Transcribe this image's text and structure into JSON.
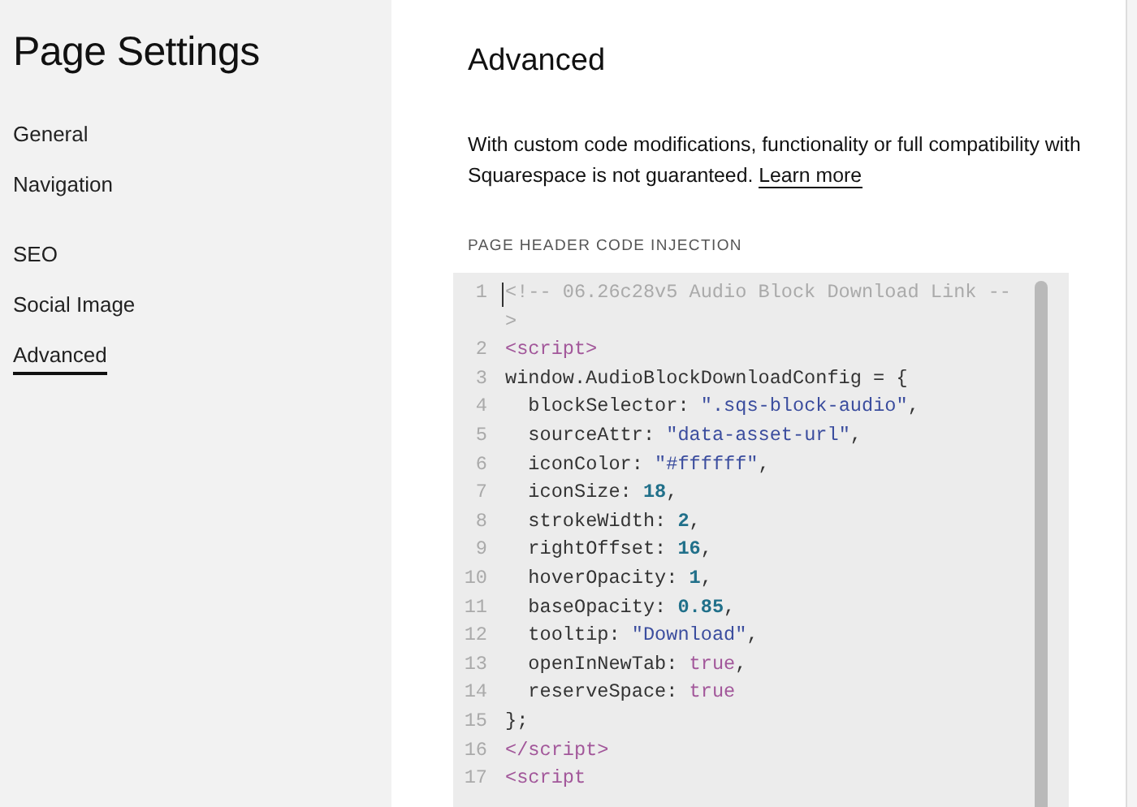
{
  "sidebar": {
    "title": "Page Settings",
    "sections": [
      {
        "items": [
          {
            "label": "General",
            "selected": false
          },
          {
            "label": "Navigation",
            "selected": false
          }
        ]
      },
      {
        "items": [
          {
            "label": "SEO",
            "selected": false
          },
          {
            "label": "Social Image",
            "selected": false
          },
          {
            "label": "Advanced",
            "selected": true
          }
        ]
      }
    ]
  },
  "main": {
    "title": "Advanced",
    "notice": {
      "text": "With custom code modifications, functionality or full compatibility with Squarespace is not guaranteed.",
      "link": "Learn more"
    },
    "code_injection": {
      "label": "PAGE HEADER CODE INJECTION",
      "lines": [
        {
          "number": "1",
          "tokens": [
            {
              "kind": "comment",
              "text": "<!-- 06.26c28v5 Audio Block Download Link -->"
            }
          ]
        },
        {
          "number": "2",
          "tokens": [
            {
              "kind": "tag",
              "text": "<script>"
            }
          ]
        },
        {
          "number": "3",
          "tokens": [
            {
              "kind": "plain",
              "text": "window.AudioBlockDownloadConfig = {"
            }
          ]
        },
        {
          "number": "4",
          "tokens": [
            {
              "kind": "plain",
              "text": "  blockSelector: "
            },
            {
              "kind": "string",
              "text": "\".sqs-block-audio\""
            },
            {
              "kind": "plain",
              "text": ","
            }
          ]
        },
        {
          "number": "5",
          "tokens": [
            {
              "kind": "plain",
              "text": "  sourceAttr: "
            },
            {
              "kind": "string",
              "text": "\"data-asset-url\""
            },
            {
              "kind": "plain",
              "text": ","
            }
          ]
        },
        {
          "number": "6",
          "tokens": [
            {
              "kind": "plain",
              "text": "  iconColor: "
            },
            {
              "kind": "string",
              "text": "\"#ffffff\""
            },
            {
              "kind": "plain",
              "text": ","
            }
          ]
        },
        {
          "number": "7",
          "tokens": [
            {
              "kind": "plain",
              "text": "  iconSize: "
            },
            {
              "kind": "number",
              "text": "18"
            },
            {
              "kind": "plain",
              "text": ","
            }
          ]
        },
        {
          "number": "8",
          "tokens": [
            {
              "kind": "plain",
              "text": "  strokeWidth: "
            },
            {
              "kind": "number",
              "text": "2"
            },
            {
              "kind": "plain",
              "text": ","
            }
          ]
        },
        {
          "number": "9",
          "tokens": [
            {
              "kind": "plain",
              "text": "  rightOffset: "
            },
            {
              "kind": "number",
              "text": "16"
            },
            {
              "kind": "plain",
              "text": ","
            }
          ]
        },
        {
          "number": "10",
          "tokens": [
            {
              "kind": "plain",
              "text": "  hoverOpacity: "
            },
            {
              "kind": "number",
              "text": "1"
            },
            {
              "kind": "plain",
              "text": ","
            }
          ]
        },
        {
          "number": "11",
          "tokens": [
            {
              "kind": "plain",
              "text": "  baseOpacity: "
            },
            {
              "kind": "number",
              "text": "0.85"
            },
            {
              "kind": "plain",
              "text": ","
            }
          ]
        },
        {
          "number": "12",
          "tokens": [
            {
              "kind": "plain",
              "text": "  tooltip: "
            },
            {
              "kind": "string",
              "text": "\"Download\""
            },
            {
              "kind": "plain",
              "text": ","
            }
          ]
        },
        {
          "number": "13",
          "tokens": [
            {
              "kind": "plain",
              "text": "  openInNewTab: "
            },
            {
              "kind": "keyword",
              "text": "true"
            },
            {
              "kind": "plain",
              "text": ","
            }
          ]
        },
        {
          "number": "14",
          "tokens": [
            {
              "kind": "plain",
              "text": "  reserveSpace: "
            },
            {
              "kind": "keyword",
              "text": "true"
            }
          ]
        },
        {
          "number": "15",
          "tokens": [
            {
              "kind": "plain",
              "text": "};"
            }
          ]
        },
        {
          "number": "16",
          "tokens": [
            {
              "kind": "tag",
              "text": "</script>"
            }
          ]
        },
        {
          "number": "17",
          "tokens": [
            {
              "kind": "tag",
              "text": "<script"
            }
          ]
        }
      ]
    }
  }
}
